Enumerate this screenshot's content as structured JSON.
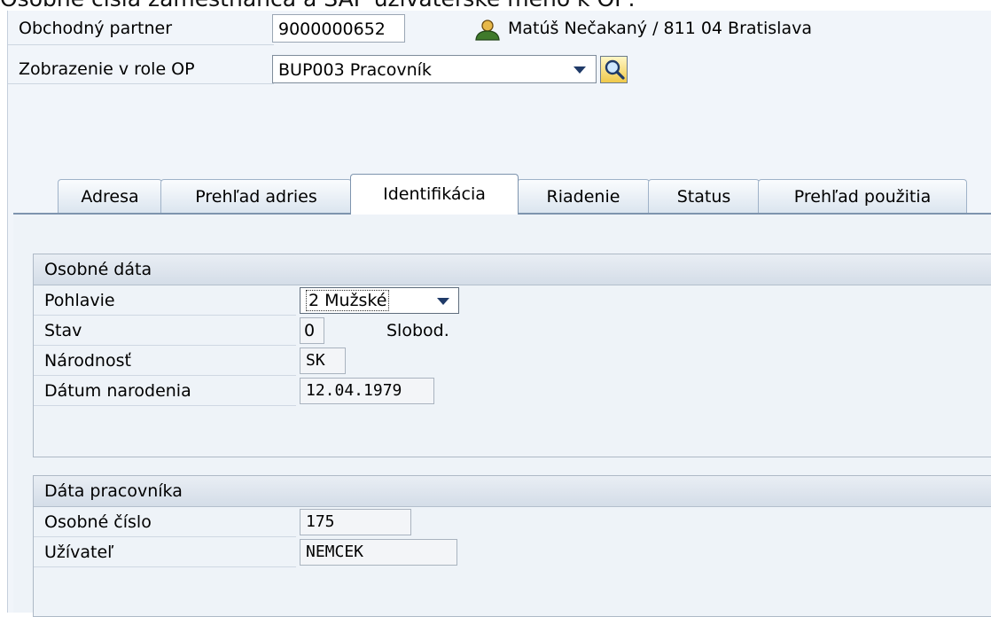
{
  "caption": "Osobné čísla zamestnanca a SAP užívateľské meno k OP:",
  "header": {
    "partner_label": "Obchodný partner",
    "partner_value": "9000000652",
    "partner_desc": "Matúš Nečakaný / 811 04 Bratislava",
    "role_label": "Zobrazenie v role OP",
    "role_value": "BUP003 Pracovník"
  },
  "icons": {
    "person": "person-icon",
    "search": "search-icon",
    "dropdown": "chevron-down-icon"
  },
  "tabs": [
    {
      "label": "Adresa",
      "active": false
    },
    {
      "label": "Prehľad adries",
      "active": false
    },
    {
      "label": "Identifikácia",
      "active": true
    },
    {
      "label": "Riadenie",
      "active": false
    },
    {
      "label": "Status",
      "active": false
    },
    {
      "label": "Prehľad použitia",
      "active": false
    }
  ],
  "personal": {
    "title": "Osobné dáta",
    "gender_label": "Pohlavie",
    "gender_value": "2 Mužské",
    "status_label": "Stav",
    "status_value": "0",
    "status_text": "Slobod.",
    "nationality_label": "Národnosť",
    "nationality_value": "SK",
    "birth_label": "Dátum narodenia",
    "birth_value": "12.04.1979"
  },
  "employee": {
    "title": "Dáta pracovníka",
    "number_label": "Osobné číslo",
    "number_value": "175",
    "user_label": "Užívateľ",
    "user_value": "NEMCEK"
  },
  "colors": {
    "window_bg": "#f1f5fa",
    "panel_bg": "#eef3f8",
    "tab_border": "#7e94ae",
    "icon_green": "#3f7a2b",
    "search_yellow": "#f0c94a"
  }
}
